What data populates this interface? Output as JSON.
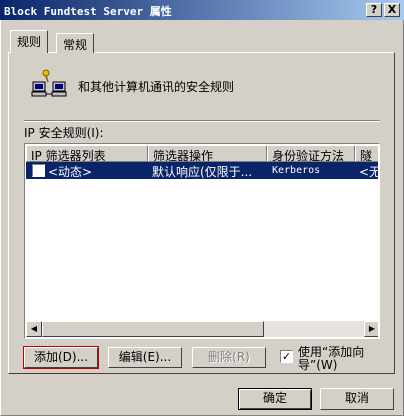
{
  "window": {
    "title": "Block Fundtest Server 属性",
    "help_label": "?",
    "close_label": "X"
  },
  "tabs": [
    {
      "label": "规则",
      "active": true
    },
    {
      "label": "常规",
      "active": false
    }
  ],
  "description": "和其他计算机通讯的安全规则",
  "rules_label": "IP 安全规则(I):",
  "list": {
    "columns": [
      "IP 筛选器列表",
      "筛选器操作",
      "身份验证方法",
      "隧"
    ],
    "rows": [
      {
        "checked": false,
        "filter_list": "<动态>",
        "filter_action": "默认响应(仅限于...",
        "auth": "Kerberos",
        "tunnel": "<无"
      }
    ]
  },
  "scroll_left": "◀",
  "scroll_right": "▶",
  "buttons": {
    "add": "添加(D)...",
    "edit": "编辑(E)...",
    "remove": "删除(R)",
    "ok": "确定",
    "cancel": "取消"
  },
  "wizard": {
    "checked": true,
    "check_mark": "✓",
    "label": "使用“添加向导”(W)"
  },
  "colors": {
    "titlebar_start": "#0a246a",
    "titlebar_end": "#a6caf0",
    "selection": "#0a246a",
    "face": "#d4d0c8"
  }
}
